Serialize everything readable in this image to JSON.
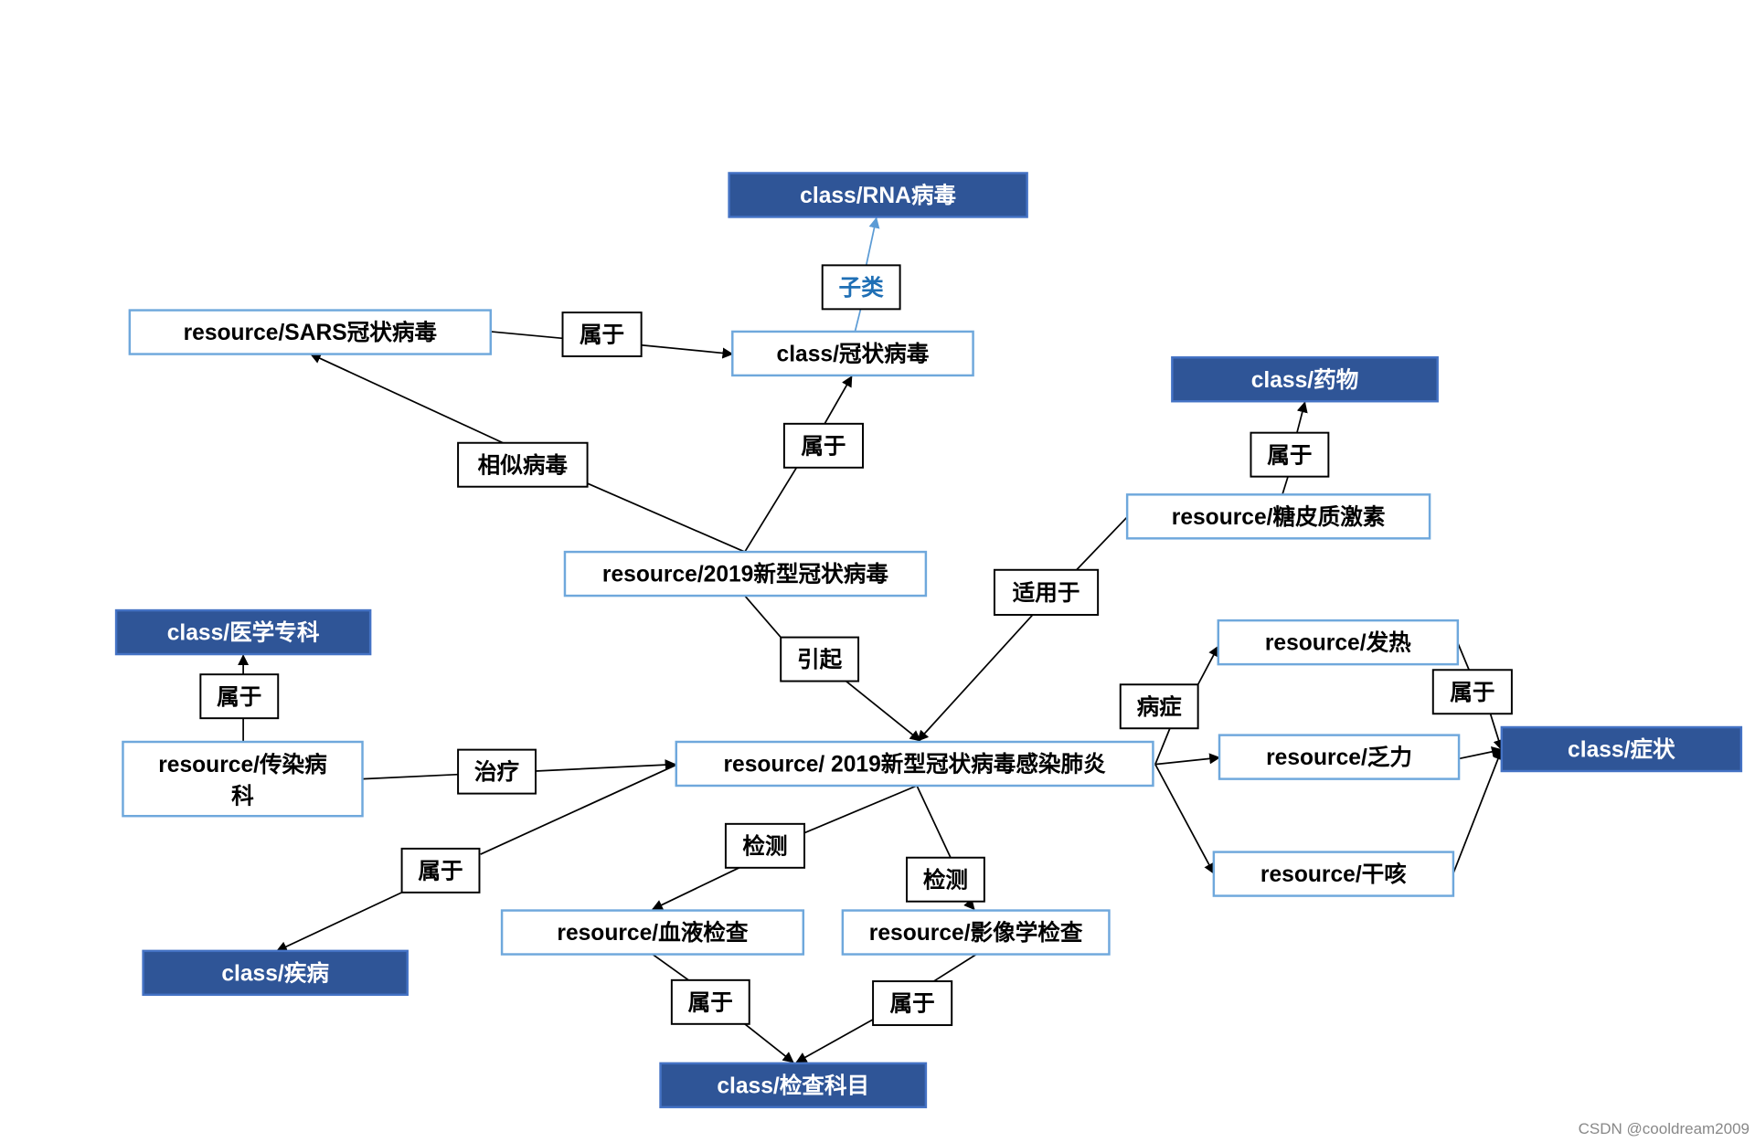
{
  "colors": {
    "class_fill": "#2f5597",
    "class_border": "#4472c4",
    "resource_border": "#6fa8dc",
    "subclass_edge": "#5b9bd5",
    "subclass_label": "#1f6fb5"
  },
  "nodes": {
    "rna": {
      "label": "class/RNA病毒",
      "kind": "class"
    },
    "coronavirus": {
      "label": "class/冠状病毒",
      "kind": "resource"
    },
    "sars": {
      "label": "resource/SARS冠状病毒",
      "kind": "resource"
    },
    "drug": {
      "label": "class/药物",
      "kind": "class"
    },
    "steroid": {
      "label": "resource/糖皮质激素",
      "kind": "resource"
    },
    "ncov": {
      "label": "resource/2019新型冠状病毒",
      "kind": "resource"
    },
    "specialty": {
      "label": "class/医学专科",
      "kind": "class"
    },
    "infectious_dept": {
      "label": "resource/传染病",
      "label2": "科",
      "kind": "resource"
    },
    "pneumonia": {
      "label": "resource/ 2019新型冠状病毒感染肺炎",
      "kind": "resource"
    },
    "fever": {
      "label": "resource/发热",
      "kind": "resource"
    },
    "fatigue": {
      "label": "resource/乏力",
      "kind": "resource"
    },
    "cough": {
      "label": "resource/干咳",
      "kind": "resource"
    },
    "symptom": {
      "label": "class/症状",
      "kind": "class"
    },
    "disease": {
      "label": "class/疾病",
      "kind": "class"
    },
    "blood_test": {
      "label": "resource/血液检查",
      "kind": "resource"
    },
    "imaging": {
      "label": "resource/影像学检查",
      "kind": "resource"
    },
    "exam": {
      "label": "class/检查科目",
      "kind": "class"
    }
  },
  "edge_labels": {
    "subclass": "子类",
    "sars_belongs": "属于",
    "similar": "相似病毒",
    "ncov_belongs": "属于",
    "steroid_belongs": "属于",
    "applies": "适用于",
    "dept_belongs": "属于",
    "causes": "引起",
    "symptom_rel": "病症",
    "symptom_belongs": "属于",
    "treats": "治疗",
    "disease_belongs": "属于",
    "detect1": "检测",
    "detect2": "检测",
    "blood_belongs": "属于",
    "imaging_belongs": "属于"
  },
  "watermark": "CSDN @cooldream2009"
}
